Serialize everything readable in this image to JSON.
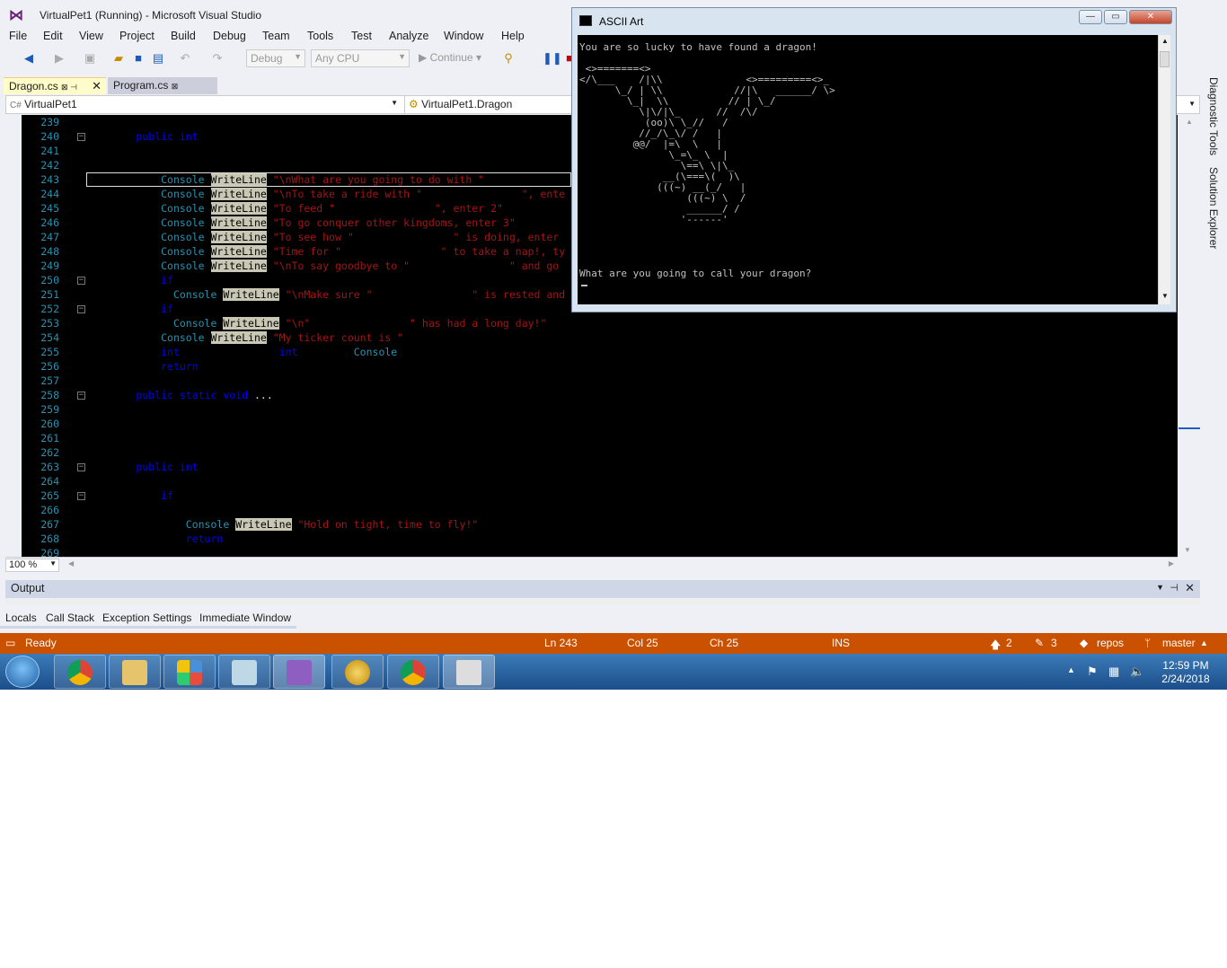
{
  "window": {
    "title": "VirtualPet1 (Running) - Microsoft Visual Studio"
  },
  "menu": [
    "File",
    "Edit",
    "View",
    "Project",
    "Build",
    "Debug",
    "Team",
    "Tools",
    "Test",
    "Analyze",
    "Window",
    "Help"
  ],
  "toolbar": {
    "config": "Debug",
    "platform": "Any CPU",
    "continue_label": "Continue"
  },
  "tabs": [
    {
      "label": "Dragon.cs",
      "pin": "⊠",
      "active": true
    },
    {
      "label": "Program.cs",
      "pin": "⊠",
      "active": false
    }
  ],
  "navbar": {
    "project": "VirtualPet1",
    "class": "VirtualPet1.Dragon"
  },
  "code_lines": [
    {
      "n": "239",
      "html": ""
    },
    {
      "n": "240",
      "html": "        <span class='kw'>public</span> <span class='kw'>int</span>"
    },
    {
      "n": "241",
      "html": ""
    },
    {
      "n": "242",
      "html": ""
    },
    {
      "n": "243",
      "html": "            <span class='ty'>Console</span> <span class='hl'>WriteLine</span> <span class='str'>\"\\nWhat are you going to do with \"</span>"
    },
    {
      "n": "244",
      "html": "            <span class='ty'>Console</span> <span class='hl'>WriteLine</span> <span class='str'>\"\\nTo take a ride with \"                \", ente</span>"
    },
    {
      "n": "245",
      "html": "            <span class='ty'>Console</span> <span class='hl'>WriteLine</span> <span class='str'>\"To feed \"                \", enter 2\"</span>"
    },
    {
      "n": "246",
      "html": "            <span class='ty'>Console</span> <span class='hl'>WriteLine</span> <span class='str'>\"To go conquer other kingdoms, enter 3\"</span>"
    },
    {
      "n": "247",
      "html": "            <span class='ty'>Console</span> <span class='hl'>WriteLine</span> <span class='str'>\"To see how \"                \" is doing, enter</span>"
    },
    {
      "n": "248",
      "html": "            <span class='ty'>Console</span> <span class='hl'>WriteLine</span> <span class='str'>\"Time for \"                \" to take a nap!, ty</span>"
    },
    {
      "n": "249",
      "html": "            <span class='ty'>Console</span> <span class='hl'>WriteLine</span> <span class='str'>\"\\nTo say goodbye to \"                \" and go</span>"
    },
    {
      "n": "250",
      "html": "            <span class='kw'>if</span>"
    },
    {
      "n": "251",
      "html": "              <span class='ty'>Console</span> <span class='hl'>WriteLine</span> <span class='str'>\"\\nMake sure \"                \" is rested and</span>"
    },
    {
      "n": "252",
      "html": "            <span class='kw'>if</span>"
    },
    {
      "n": "253",
      "html": "              <span class='ty'>Console</span> <span class='hl'>WriteLine</span> <span class='str'>\"\\n\"                \" has had a long day!\"</span>"
    },
    {
      "n": "254",
      "html": "            <span class='ty'>Console</span> <span class='hl'>WriteLine</span> <span class='str'>\"My ticker count is \"</span>"
    },
    {
      "n": "255",
      "html": "            <span class='kw'>int</span>                <span class='kw'>int</span>         <span class='ty'>Console</span>"
    },
    {
      "n": "256",
      "html": "            <span class='kw'>return</span>"
    },
    {
      "n": "257",
      "html": ""
    },
    {
      "n": "258",
      "html": "        <span class='kw'>public</span> <span class='kw'>static</span> <span class='kw'>void</span> <span class='wh'>...</span>"
    },
    {
      "n": "259",
      "html": ""
    },
    {
      "n": "260",
      "html": ""
    },
    {
      "n": "261",
      "html": ""
    },
    {
      "n": "262",
      "html": ""
    },
    {
      "n": "263",
      "html": "        <span class='kw'>public</span> <span class='kw'>int</span>"
    },
    {
      "n": "264",
      "html": ""
    },
    {
      "n": "265",
      "html": "            <span class='kw'>if</span>"
    },
    {
      "n": "266",
      "html": ""
    },
    {
      "n": "267",
      "html": "                <span class='ty'>Console</span> <span class='hl'>WriteLine</span> <span class='str'>\"Hold on tight, time to fly!\"</span>"
    },
    {
      "n": "268",
      "html": "                <span class='kw'>return</span>"
    },
    {
      "n": "269",
      "html": ""
    }
  ],
  "zoom": "100 %",
  "output_title": "Output",
  "bottom_tabs": [
    "Locals",
    "Call Stack",
    "Exception Settings",
    "Immediate Window"
  ],
  "status": {
    "ready": "Ready",
    "ln": "Ln 243",
    "col": "Col 25",
    "ch": "Ch 25",
    "ins": "INS",
    "up": "2",
    "pencil": "3",
    "repo": "repos",
    "branch": "master"
  },
  "right_panels": [
    "Diagnostic Tools",
    "Solution Explorer"
  ],
  "console": {
    "title": "ASCII Art",
    "lines": [
      "You are so lucky to have found a dragon!",
      "",
      " <>=======<>",
      "</\\___    /|\\\\              <>=========<>_",
      "      \\_/ | \\\\            //|\\   ______/ \\>",
      "        \\_|  \\\\          // | \\_/",
      "          \\|\\/|\\_      //  /\\/",
      "           (oo)\\ \\_//   /",
      "          //_/\\_\\/ /   |",
      "         @@/  |=\\  \\   |",
      "               \\_=\\_ \\  |",
      "                 \\==\\ \\|\\_",
      "              __(\\===\\(  )\\",
      "             (((~) __(_/   |",
      "                  (((~) \\  /",
      "                  ______/ /",
      "                 '------'",
      "",
      "",
      "",
      "",
      "What are you going to call your dragon?"
    ]
  },
  "taskbar": {
    "time": "12:59 PM",
    "date": "2/24/2018"
  }
}
